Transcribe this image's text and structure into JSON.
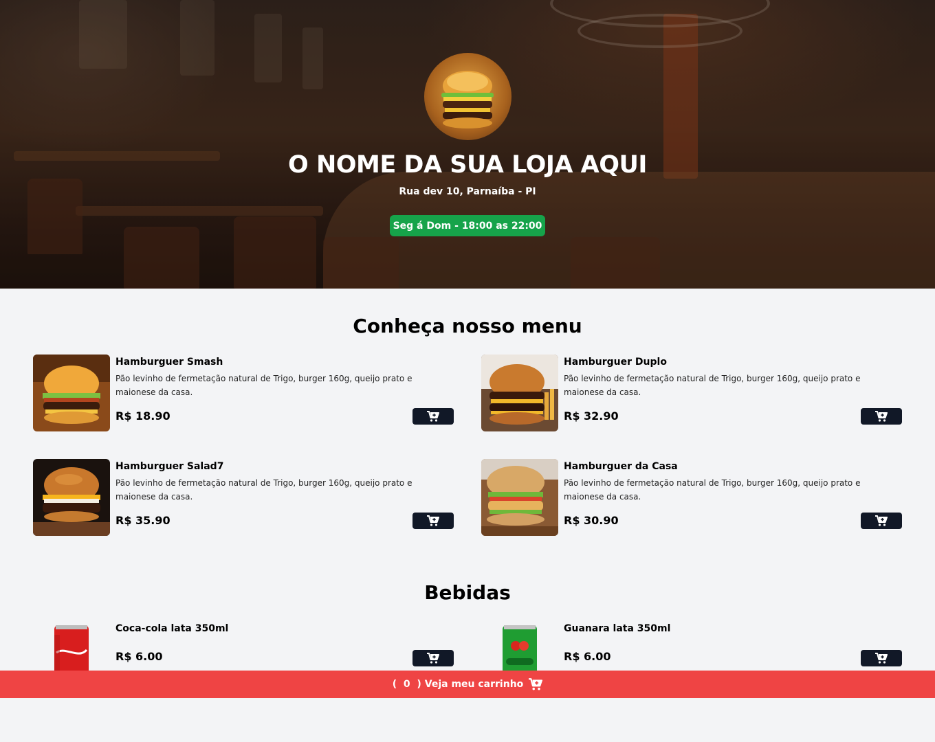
{
  "header": {
    "store_name": "O NOME DA SUA LOJA AQUI",
    "address": "Rua dev 10, Parnaíba - PI",
    "hours": "Seg á Dom - 18:00 as 22:00",
    "hours_badge_color": "#16a34a"
  },
  "menu": {
    "title": "Conheça nosso menu",
    "items": [
      {
        "name": "Hamburguer Smash",
        "description": "Pão levinho de fermetação natural de Trigo, burger 160g, queijo prato e maionese da casa.",
        "price": "R$ 18.90"
      },
      {
        "name": "Hamburguer Duplo",
        "description": "Pão levinho de fermetação natural de Trigo, burger 160g, queijo prato e maionese da casa.",
        "price": "R$ 32.90"
      },
      {
        "name": "Hamburguer Salad7",
        "description": "Pão levinho de fermetação natural de Trigo, burger 160g, queijo prato e maionese da casa.",
        "price": "R$ 35.90"
      },
      {
        "name": "Hamburguer da Casa",
        "description": "Pão levinho de fermetação natural de Trigo, burger 160g, queijo prato e maionese da casa.",
        "price": "R$ 30.90"
      }
    ]
  },
  "drinks": {
    "title": "Bebidas",
    "items": [
      {
        "name": "Coca-cola lata 350ml",
        "price": "R$ 6.00"
      },
      {
        "name": "Guanara lata 350ml",
        "price": "R$ 6.00"
      }
    ]
  },
  "cart": {
    "open_paren": "(",
    "count": "0",
    "close_paren": ")",
    "label": "Veja meu carrinho",
    "bar_color": "#ef4444"
  },
  "icons": {
    "add_to_cart": "cart-plus-icon",
    "cart": "cart-plus-icon"
  }
}
